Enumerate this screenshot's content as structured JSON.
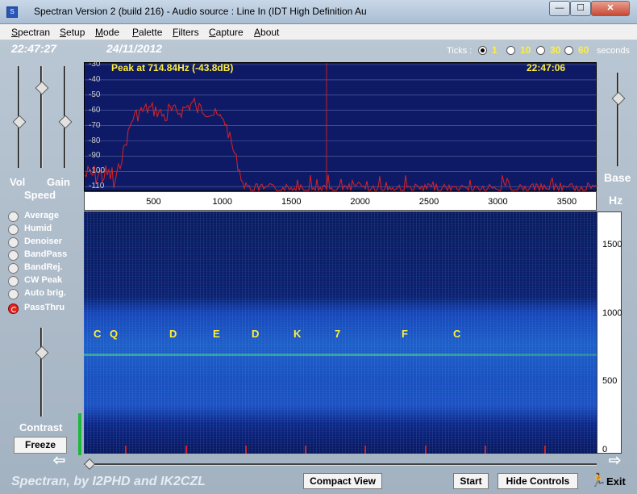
{
  "window": {
    "title": "Spectran Version 2 (build 216) - Audio source  :  Line In (IDT High Definition Au",
    "minimize_label": "—",
    "maximize_label": "☐",
    "close_label": "✕"
  },
  "menu": [
    "Spectran",
    "Setup",
    "Mode",
    "Palette",
    "Filters",
    "Capture",
    "About"
  ],
  "header": {
    "time": "22:47:27",
    "date": "24/11/2012",
    "ticks_label": "Ticks :",
    "tick_options": [
      "1",
      "10",
      "30",
      "60"
    ],
    "tick_selected": "1",
    "seconds_label": "seconds"
  },
  "left_panel": {
    "vol_label": "Vol",
    "gain_label": "Gain",
    "speed_label": "Speed",
    "slider_levels": {
      "vol": 0.55,
      "gain": 0.18,
      "speed": 0.55,
      "contrast": 0.25
    },
    "options": [
      {
        "label": "Average",
        "on": false
      },
      {
        "label": "Humid",
        "on": false
      },
      {
        "label": "Denoiser",
        "on": false
      },
      {
        "label": "BandPass",
        "on": false
      },
      {
        "label": "BandRej.",
        "on": false
      },
      {
        "label": "CW Peak",
        "on": false
      },
      {
        "label": "Auto brig.",
        "on": false
      },
      {
        "label": "PassThru",
        "on": true
      }
    ],
    "contrast_label": "Contrast",
    "freeze_label": "Freeze"
  },
  "right_panel": {
    "base_label": "Base",
    "hz_label": "Hz",
    "base_level": 0.25,
    "waterfall_ticks": [
      "1500",
      "1000",
      "500",
      "0"
    ]
  },
  "spectrum": {
    "peak_text": "Peak at   714.84Hz (-43.8dB)",
    "time": "22:47:06",
    "y_ticks": [
      "-30",
      "-40",
      "-50",
      "-60",
      "-70",
      "-80",
      "-90",
      "-100",
      "-110"
    ],
    "x_ticks": [
      "500",
      "1000",
      "1500",
      "2000",
      "2500",
      "3000",
      "3500"
    ]
  },
  "waterfall": {
    "decoded_chars": [
      "C",
      "Q",
      "D",
      "E",
      "D",
      "K",
      "7",
      "F",
      "C"
    ]
  },
  "footer": {
    "credit": "Spectran, by I2PHD and IK2CZL",
    "compact_view_label": "Compact View",
    "start_label": "Start",
    "hide_controls_label": "Hide Controls",
    "exit_label": "Exit"
  },
  "colors": {
    "accent_yellow": "#ffef3a",
    "spectrum_bg": "#0e1a66",
    "trace_red": "#e02020",
    "selected_option": "#e3261a"
  }
}
